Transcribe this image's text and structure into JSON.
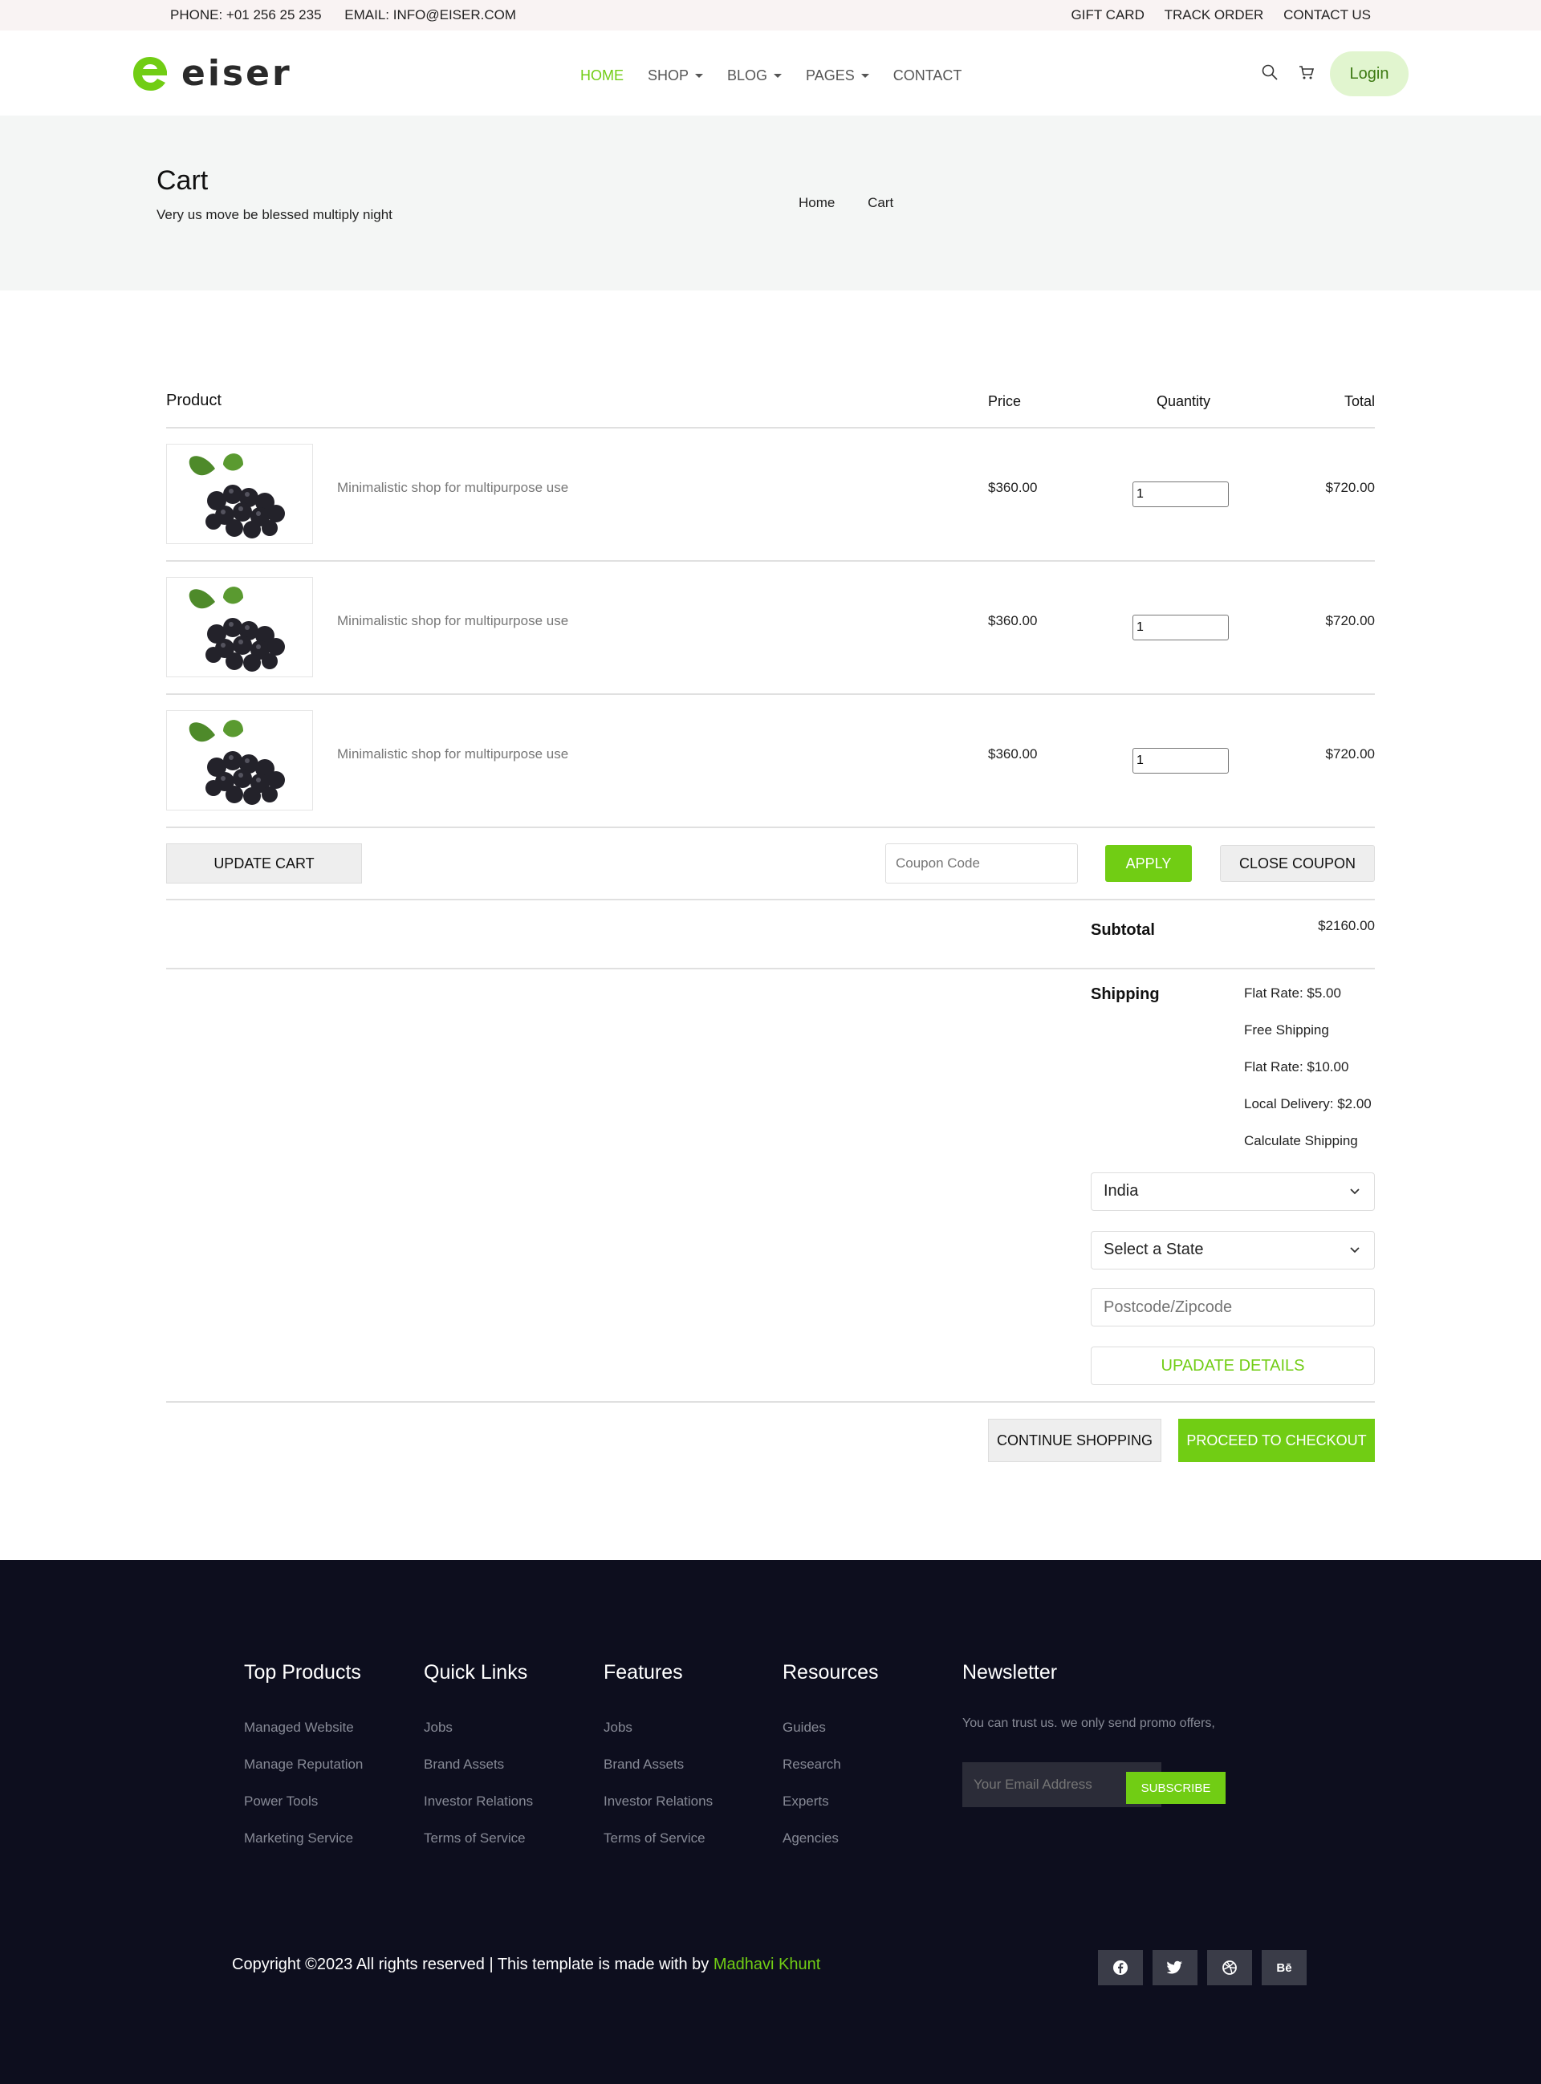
{
  "topbar": {
    "phone": "PHONE: +01 256 25 235",
    "email": "EMAIL: INFO@EISER.COM",
    "links": [
      "GIFT CARD",
      "TRACK ORDER",
      "CONTACT US"
    ]
  },
  "header": {
    "logo_text": "eiser",
    "nav": [
      "HOME",
      "SHOP",
      "BLOG",
      "PAGES",
      "CONTACT"
    ],
    "login": "Login"
  },
  "banner": {
    "title": "Cart",
    "subtitle": "Very us move be blessed multiply night",
    "breadcrumb": [
      "Home",
      "Cart"
    ]
  },
  "cart": {
    "headers": {
      "product": "Product",
      "price": "Price",
      "quantity": "Quantity",
      "total": "Total"
    },
    "items": [
      {
        "name": "Minimalistic shop for multipurpose use",
        "price": "$360.00",
        "qty": "1",
        "total": "$720.00"
      },
      {
        "name": "Minimalistic shop for multipurpose use",
        "price": "$360.00",
        "qty": "1",
        "total": "$720.00"
      },
      {
        "name": "Minimalistic shop for multipurpose use",
        "price": "$360.00",
        "qty": "1",
        "total": "$720.00"
      }
    ],
    "update_cart": "UPDATE CART",
    "coupon_placeholder": "Coupon Code",
    "apply": "APPLY",
    "close_coupon": "CLOSE COUPON",
    "subtotal_label": "Subtotal",
    "subtotal_value": "$2160.00",
    "shipping_label": "Shipping",
    "shipping_options": [
      "Flat Rate: $5.00",
      "Free Shipping",
      "Flat Rate: $10.00",
      "Local Delivery: $2.00",
      "Calculate Shipping"
    ],
    "country": "India",
    "state": "Select a State",
    "postcode_placeholder": "Postcode/Zipcode",
    "update_details": "UPADATE DETAILS",
    "continue_shopping": "CONTINUE SHOPPING",
    "proceed_checkout": "PROCEED TO CHECKOUT"
  },
  "footer": {
    "columns": [
      {
        "title": "Top Products",
        "links": [
          "Managed Website",
          "Manage Reputation",
          "Power Tools",
          "Marketing Service"
        ]
      },
      {
        "title": "Quick Links",
        "links": [
          "Jobs",
          "Brand Assets",
          "Investor Relations",
          "Terms of Service"
        ]
      },
      {
        "title": "Features",
        "links": [
          "Jobs",
          "Brand Assets",
          "Investor Relations",
          "Terms of Service"
        ]
      },
      {
        "title": "Resources",
        "links": [
          "Guides",
          "Research",
          "Experts",
          "Agencies"
        ]
      }
    ],
    "newsletter": {
      "title": "Newsletter",
      "text": "You can trust us. we only send promo offers,",
      "placeholder": "Your Email Address",
      "button": "SUBSCRIBE"
    },
    "copyright_prefix": "Copyright ©2023 All rights reserved | This template is made with by ",
    "copyright_author": "Madhavi Khunt",
    "socials": [
      "facebook-icon",
      "twitter-icon",
      "dribbble-icon",
      "behance-icon"
    ],
    "behance_text": "Bē"
  },
  "colors": {
    "accent": "#71cd14",
    "footer_bg": "#0d0e1e",
    "banner_bg": "#f4f6f5"
  }
}
